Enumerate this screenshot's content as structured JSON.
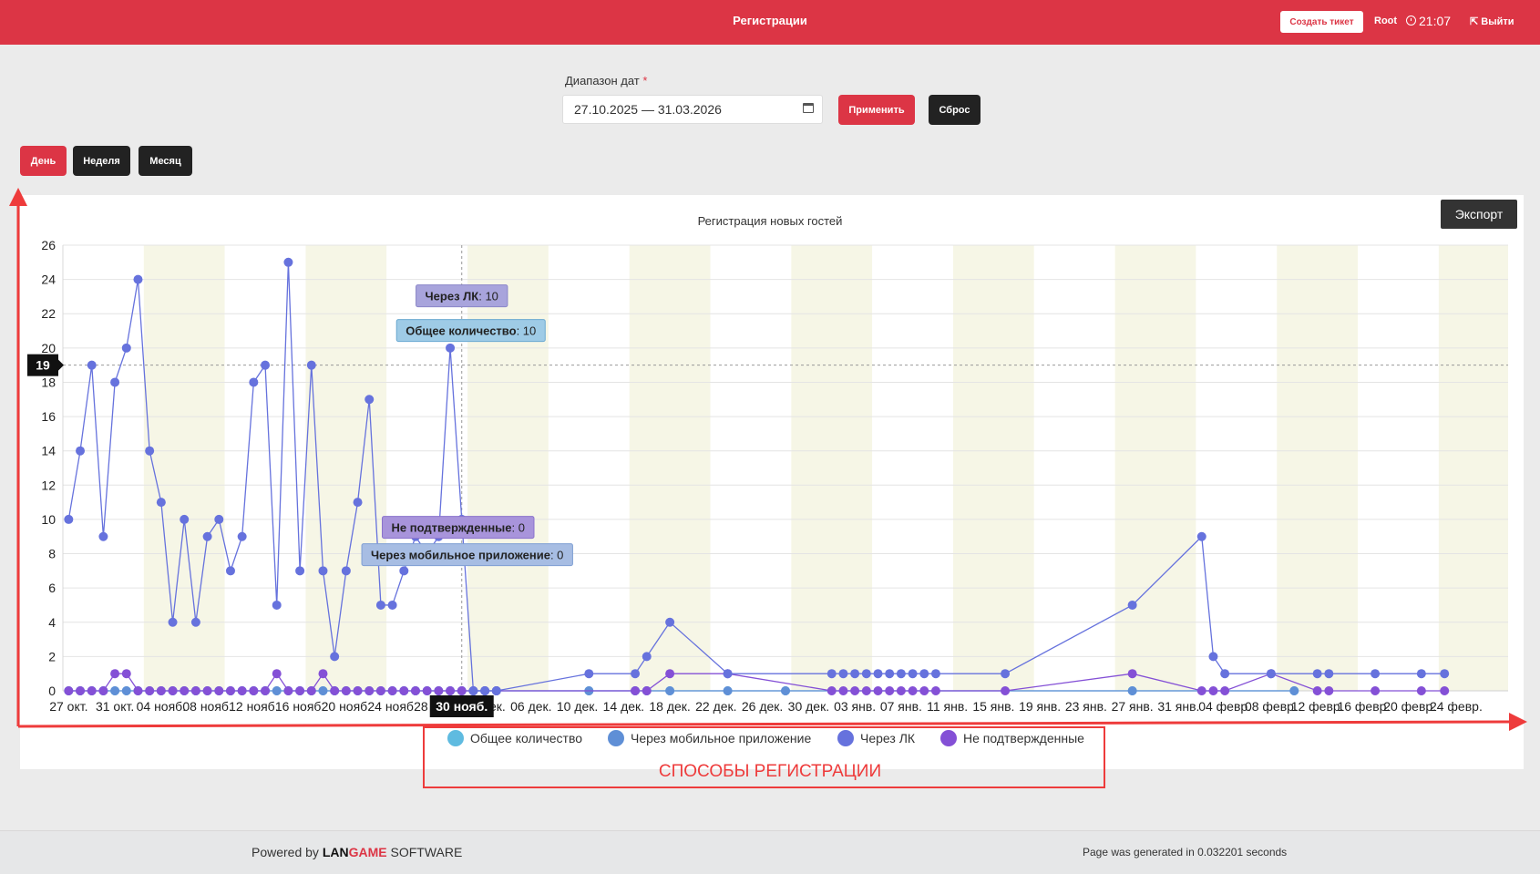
{
  "header": {
    "title": "Регистрации",
    "ticket_button": "Создать тикет",
    "user": "Root",
    "time": "21:07",
    "logout": "Выйти"
  },
  "filters": {
    "date_range_label": "Диапазон дат",
    "required_mark": "*",
    "date_range_value": "27.10.2025 — 31.03.2026",
    "apply_button": "Применить",
    "reset_button": "Сброс"
  },
  "period_buttons": {
    "day": "День",
    "week": "Неделя",
    "month": "Месяц"
  },
  "export_button": "Экспорт",
  "annotation": "СПОСОБЫ РЕГИСТРАЦИИ",
  "footer": {
    "powered_prefix": "Powered by",
    "brand_part1": "LAN",
    "brand_part2": "GAME",
    "brand_part3": " SOFTWARE",
    "generated": "Page was generated in 0.032201 seconds"
  },
  "colors": {
    "accent_red": "#dc3545",
    "series_total": "#5fbbe0",
    "series_mobile": "#5f8fd6",
    "series_lk": "#6672dd",
    "series_unconfirmed": "#8450d6",
    "annotation_red": "#ee3b3b"
  },
  "chart_data": {
    "type": "line",
    "title": "Регистрация новых гостей",
    "xlabel": "",
    "ylabel": "",
    "ylim": [
      0,
      26
    ],
    "y_ticks": [
      0,
      2,
      4,
      6,
      8,
      10,
      12,
      14,
      16,
      18,
      20,
      22,
      24,
      26
    ],
    "x_tick_labels": [
      "27 окт.",
      "31 окт.",
      "04 нояб.",
      "08 нояб.",
      "12 нояб.",
      "16 нояб.",
      "20 нояб.",
      "24 нояб.",
      "28 нояб.",
      "02 дек.",
      "06 дек.",
      "10 дек.",
      "14 дек.",
      "18 дек.",
      "22 дек.",
      "26 дек.",
      "30 дек.",
      "03 янв.",
      "07 янв.",
      "11 янв.",
      "15 янв.",
      "19 янв.",
      "23 янв.",
      "27 янв.",
      "31 янв.",
      "04 февр.",
      "08 февр.",
      "12 февр.",
      "16 февр.",
      "20 февр.",
      "24 февр."
    ],
    "x_start": "2025-10-27",
    "x_end": "2026-02-28",
    "grid": true,
    "legend_position": "bottom",
    "crosshair": {
      "x": "2025-11-30",
      "y": 19,
      "x_label": "30 нояб.",
      "y_label": "19"
    },
    "series": [
      {
        "name": "Общее количество",
        "points": [
          [
            "2025-10-27",
            0
          ],
          [
            "2025-10-28",
            0
          ],
          [
            "2025-10-29",
            0
          ],
          [
            "2025-10-30",
            0
          ],
          [
            "2025-10-31",
            0
          ],
          [
            "2025-11-01",
            0
          ],
          [
            "2025-11-02",
            0
          ],
          [
            "2025-11-03",
            0
          ],
          [
            "2025-11-04",
            0
          ],
          [
            "2025-11-05",
            0
          ],
          [
            "2025-11-06",
            0
          ],
          [
            "2025-11-07",
            0
          ],
          [
            "2025-11-08",
            0
          ],
          [
            "2025-11-09",
            0
          ],
          [
            "2025-11-10",
            0
          ],
          [
            "2025-11-11",
            0
          ],
          [
            "2025-11-12",
            0
          ],
          [
            "2025-11-13",
            0
          ],
          [
            "2025-11-14",
            0
          ],
          [
            "2025-11-15",
            0
          ],
          [
            "2025-11-16",
            0
          ],
          [
            "2025-11-17",
            0
          ],
          [
            "2025-11-18",
            0
          ],
          [
            "2025-11-19",
            0
          ],
          [
            "2025-11-20",
            0
          ],
          [
            "2025-11-21",
            0
          ],
          [
            "2025-11-22",
            0
          ],
          [
            "2025-11-23",
            0
          ],
          [
            "2025-11-24",
            0
          ],
          [
            "2025-11-25",
            0
          ],
          [
            "2025-11-26",
            0
          ],
          [
            "2025-11-27",
            0
          ],
          [
            "2025-11-28",
            0
          ],
          [
            "2025-11-29",
            0
          ],
          [
            "2025-11-30",
            0
          ],
          [
            "2025-12-01",
            0
          ],
          [
            "2025-12-02",
            0
          ],
          [
            "2025-12-03",
            0
          ],
          [
            "2025-12-11",
            0
          ],
          [
            "2025-12-15",
            0
          ],
          [
            "2025-12-16",
            0
          ],
          [
            "2025-12-18",
            0
          ],
          [
            "2025-12-23",
            0
          ],
          [
            "2025-12-28",
            0
          ],
          [
            "2026-01-27",
            0
          ],
          [
            "2026-02-10",
            0
          ]
        ]
      },
      {
        "name": "Через мобильное приложение",
        "points": [
          [
            "2025-10-27",
            0
          ],
          [
            "2025-10-28",
            0
          ],
          [
            "2025-10-29",
            0
          ],
          [
            "2025-10-30",
            0
          ],
          [
            "2025-10-31",
            0
          ],
          [
            "2025-11-01",
            0
          ],
          [
            "2025-11-02",
            0
          ],
          [
            "2025-11-03",
            0
          ],
          [
            "2025-11-04",
            0
          ],
          [
            "2025-11-05",
            0
          ],
          [
            "2025-11-06",
            0
          ],
          [
            "2025-11-07",
            0
          ],
          [
            "2025-11-08",
            0
          ],
          [
            "2025-11-09",
            0
          ],
          [
            "2025-11-10",
            0
          ],
          [
            "2025-11-11",
            0
          ],
          [
            "2025-11-12",
            0
          ],
          [
            "2025-11-13",
            0
          ],
          [
            "2025-11-14",
            0
          ],
          [
            "2025-11-15",
            0
          ],
          [
            "2025-11-16",
            0
          ],
          [
            "2025-11-17",
            0
          ],
          [
            "2025-11-18",
            0
          ],
          [
            "2025-11-19",
            0
          ],
          [
            "2025-11-20",
            0
          ],
          [
            "2025-11-21",
            0
          ],
          [
            "2025-11-22",
            0
          ],
          [
            "2025-11-23",
            0
          ],
          [
            "2025-11-24",
            0
          ],
          [
            "2025-11-25",
            0
          ],
          [
            "2025-11-26",
            0
          ],
          [
            "2025-11-27",
            0
          ],
          [
            "2025-11-28",
            0
          ],
          [
            "2025-11-29",
            0
          ],
          [
            "2025-11-30",
            0
          ],
          [
            "2025-12-01",
            0
          ],
          [
            "2025-12-02",
            0
          ],
          [
            "2025-12-03",
            0
          ],
          [
            "2025-12-11",
            0
          ],
          [
            "2025-12-15",
            0
          ],
          [
            "2025-12-16",
            0
          ],
          [
            "2025-12-18",
            0
          ],
          [
            "2025-12-23",
            0
          ],
          [
            "2025-12-28",
            0
          ],
          [
            "2026-01-27",
            0
          ],
          [
            "2026-02-10",
            0
          ]
        ]
      },
      {
        "name": "Через ЛК",
        "points": [
          [
            "2025-10-27",
            10
          ],
          [
            "2025-10-28",
            14
          ],
          [
            "2025-10-29",
            19
          ],
          [
            "2025-10-30",
            9
          ],
          [
            "2025-10-31",
            18
          ],
          [
            "2025-11-01",
            20
          ],
          [
            "2025-11-02",
            24
          ],
          [
            "2025-11-03",
            14
          ],
          [
            "2025-11-04",
            11
          ],
          [
            "2025-11-05",
            4
          ],
          [
            "2025-11-06",
            10
          ],
          [
            "2025-11-07",
            4
          ],
          [
            "2025-11-08",
            9
          ],
          [
            "2025-11-09",
            10
          ],
          [
            "2025-11-10",
            7
          ],
          [
            "2025-11-11",
            9
          ],
          [
            "2025-11-12",
            18
          ],
          [
            "2025-11-13",
            19
          ],
          [
            "2025-11-14",
            5
          ],
          [
            "2025-11-15",
            25
          ],
          [
            "2025-11-16",
            7
          ],
          [
            "2025-11-17",
            19
          ],
          [
            "2025-11-18",
            7
          ],
          [
            "2025-11-19",
            2
          ],
          [
            "2025-11-20",
            7
          ],
          [
            "2025-11-21",
            11
          ],
          [
            "2025-11-22",
            17
          ],
          [
            "2025-11-23",
            5
          ],
          [
            "2025-11-24",
            5
          ],
          [
            "2025-11-25",
            7
          ],
          [
            "2025-11-26",
            9
          ],
          [
            "2025-11-27",
            8
          ],
          [
            "2025-11-28",
            9
          ],
          [
            "2025-11-29",
            20
          ],
          [
            "2025-11-30",
            10
          ],
          [
            "2025-12-01",
            0
          ],
          [
            "2025-12-02",
            0
          ],
          [
            "2025-12-03",
            0
          ],
          [
            "2025-12-11",
            1
          ],
          [
            "2025-12-15",
            1
          ],
          [
            "2025-12-16",
            2
          ],
          [
            "2025-12-18",
            4
          ],
          [
            "2025-12-23",
            1
          ],
          [
            "2026-01-01",
            1
          ],
          [
            "2026-01-02",
            1
          ],
          [
            "2026-01-03",
            1
          ],
          [
            "2026-01-04",
            1
          ],
          [
            "2026-01-05",
            1
          ],
          [
            "2026-01-06",
            1
          ],
          [
            "2026-01-07",
            1
          ],
          [
            "2026-01-08",
            1
          ],
          [
            "2026-01-09",
            1
          ],
          [
            "2026-01-10",
            1
          ],
          [
            "2026-01-16",
            1
          ],
          [
            "2026-01-27",
            5
          ],
          [
            "2026-02-02",
            9
          ],
          [
            "2026-02-03",
            2
          ],
          [
            "2026-02-04",
            1
          ],
          [
            "2026-02-08",
            1
          ],
          [
            "2026-02-12",
            1
          ],
          [
            "2026-02-13",
            1
          ],
          [
            "2026-02-17",
            1
          ],
          [
            "2026-02-21",
            1
          ],
          [
            "2026-02-23",
            1
          ]
        ]
      },
      {
        "name": "Не подтвержденные",
        "points": [
          [
            "2025-10-27",
            0
          ],
          [
            "2025-10-28",
            0
          ],
          [
            "2025-10-29",
            0
          ],
          [
            "2025-10-30",
            0
          ],
          [
            "2025-10-31",
            1
          ],
          [
            "2025-11-01",
            1
          ],
          [
            "2025-11-02",
            0
          ],
          [
            "2025-11-03",
            0
          ],
          [
            "2025-11-04",
            0
          ],
          [
            "2025-11-05",
            0
          ],
          [
            "2025-11-06",
            0
          ],
          [
            "2025-11-07",
            0
          ],
          [
            "2025-11-08",
            0
          ],
          [
            "2025-11-09",
            0
          ],
          [
            "2025-11-10",
            0
          ],
          [
            "2025-11-11",
            0
          ],
          [
            "2025-11-12",
            0
          ],
          [
            "2025-11-13",
            0
          ],
          [
            "2025-11-14",
            1
          ],
          [
            "2025-11-15",
            0
          ],
          [
            "2025-11-16",
            0
          ],
          [
            "2025-11-17",
            0
          ],
          [
            "2025-11-18",
            1
          ],
          [
            "2025-11-19",
            0
          ],
          [
            "2025-11-20",
            0
          ],
          [
            "2025-11-21",
            0
          ],
          [
            "2025-11-22",
            0
          ],
          [
            "2025-11-23",
            0
          ],
          [
            "2025-11-24",
            0
          ],
          [
            "2025-11-25",
            0
          ],
          [
            "2025-11-26",
            0
          ],
          [
            "2025-11-27",
            0
          ],
          [
            "2025-11-28",
            0
          ],
          [
            "2025-11-29",
            0
          ],
          [
            "2025-11-30",
            0
          ],
          [
            "2025-12-01",
            0
          ],
          [
            "2025-12-02",
            0
          ],
          [
            "2025-12-03",
            0
          ],
          [
            "2025-12-15",
            0
          ],
          [
            "2025-12-16",
            0
          ],
          [
            "2025-12-18",
            1
          ],
          [
            "2025-12-23",
            1
          ],
          [
            "2026-01-01",
            0
          ],
          [
            "2026-01-02",
            0
          ],
          [
            "2026-01-03",
            0
          ],
          [
            "2026-01-04",
            0
          ],
          [
            "2026-01-05",
            0
          ],
          [
            "2026-01-06",
            0
          ],
          [
            "2026-01-07",
            0
          ],
          [
            "2026-01-08",
            0
          ],
          [
            "2026-01-09",
            0
          ],
          [
            "2026-01-10",
            0
          ],
          [
            "2026-01-16",
            0
          ],
          [
            "2026-01-27",
            1
          ],
          [
            "2026-02-02",
            0
          ],
          [
            "2026-02-03",
            0
          ],
          [
            "2026-02-04",
            0
          ],
          [
            "2026-02-08",
            1
          ],
          [
            "2026-02-12",
            0
          ],
          [
            "2026-02-13",
            0
          ],
          [
            "2026-02-17",
            0
          ],
          [
            "2026-02-21",
            0
          ],
          [
            "2026-02-23",
            0
          ]
        ]
      }
    ],
    "tooltips": [
      {
        "series": "Через ЛК",
        "value": 10
      },
      {
        "series": "Общее количество",
        "value": 10
      },
      {
        "series": "Не подтвержденные",
        "value": 0
      },
      {
        "series": "Через мобильное приложение",
        "value": 0
      }
    ]
  }
}
